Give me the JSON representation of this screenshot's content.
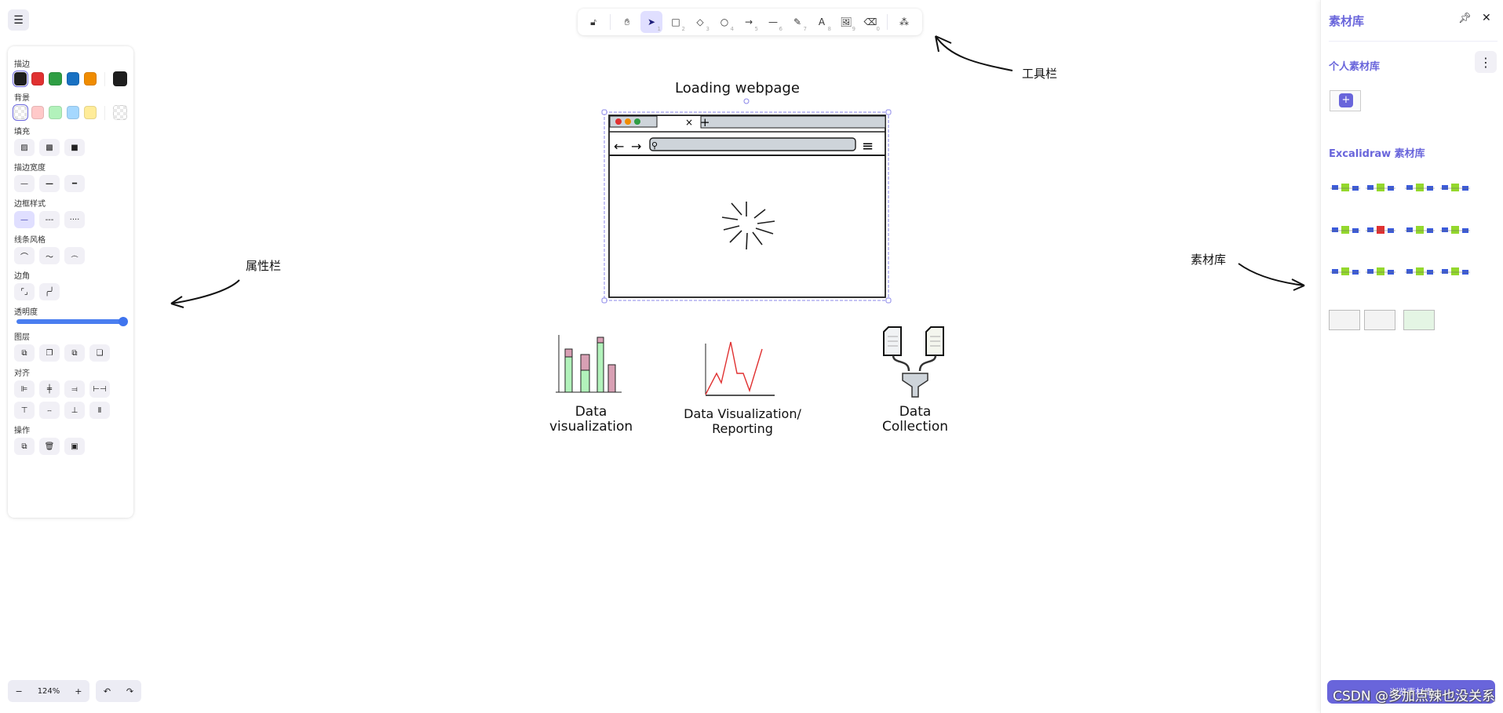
{
  "menu": {
    "icon": "hamburger-icon"
  },
  "properties": {
    "stroke_label": "描边",
    "stroke_colors": [
      "#1e1e1e",
      "#e03131",
      "#2f9e44",
      "#1971c2",
      "#f08c00"
    ],
    "stroke_current": "#1e1e1e",
    "background_label": "背景",
    "background_colors": [
      "transparent",
      "#ffc9c9",
      "#b2f2bb",
      "#a5d8ff",
      "#ffec99"
    ],
    "fill_label": "填充",
    "stroke_width_label": "描边宽度",
    "stroke_style_label": "边框样式",
    "sloppiness_label": "线条风格",
    "edges_label": "边角",
    "opacity_label": "透明度",
    "opacity_value": 100,
    "layers_label": "图层",
    "align_label": "对齐",
    "actions_label": "操作"
  },
  "toolbar": {
    "tools": [
      {
        "name": "hand",
        "key": ""
      },
      {
        "name": "selection",
        "key": "1",
        "active": true
      },
      {
        "name": "rectangle",
        "key": "2"
      },
      {
        "name": "diamond",
        "key": "3"
      },
      {
        "name": "ellipse",
        "key": "4"
      },
      {
        "name": "arrow",
        "key": "5"
      },
      {
        "name": "line",
        "key": "6"
      },
      {
        "name": "draw",
        "key": "7"
      },
      {
        "name": "text",
        "key": "8"
      },
      {
        "name": "image",
        "key": "9"
      },
      {
        "name": "eraser",
        "key": "0"
      }
    ]
  },
  "canvas": {
    "browser_title": "Loading webpage",
    "icon1_label_1": "Data",
    "icon1_label_2": "visualization",
    "icon2_label_1": "Data Visualization/",
    "icon2_label_2": "Reporting",
    "icon3_label_1": "Data",
    "icon3_label_2": "Collection",
    "annotation_toolbar": "工具栏",
    "annotation_properties": "属性栏",
    "annotation_library": "素材库"
  },
  "library": {
    "title": "素材库",
    "personal_title": "个人素材库",
    "excalidraw_title": "Excalidraw 素材库",
    "browse_label": "浏览素材库"
  },
  "footer": {
    "zoom": "124%",
    "zoom_out": "−",
    "zoom_in": "+"
  },
  "watermark": "CSDN @多加点辣也没关系"
}
